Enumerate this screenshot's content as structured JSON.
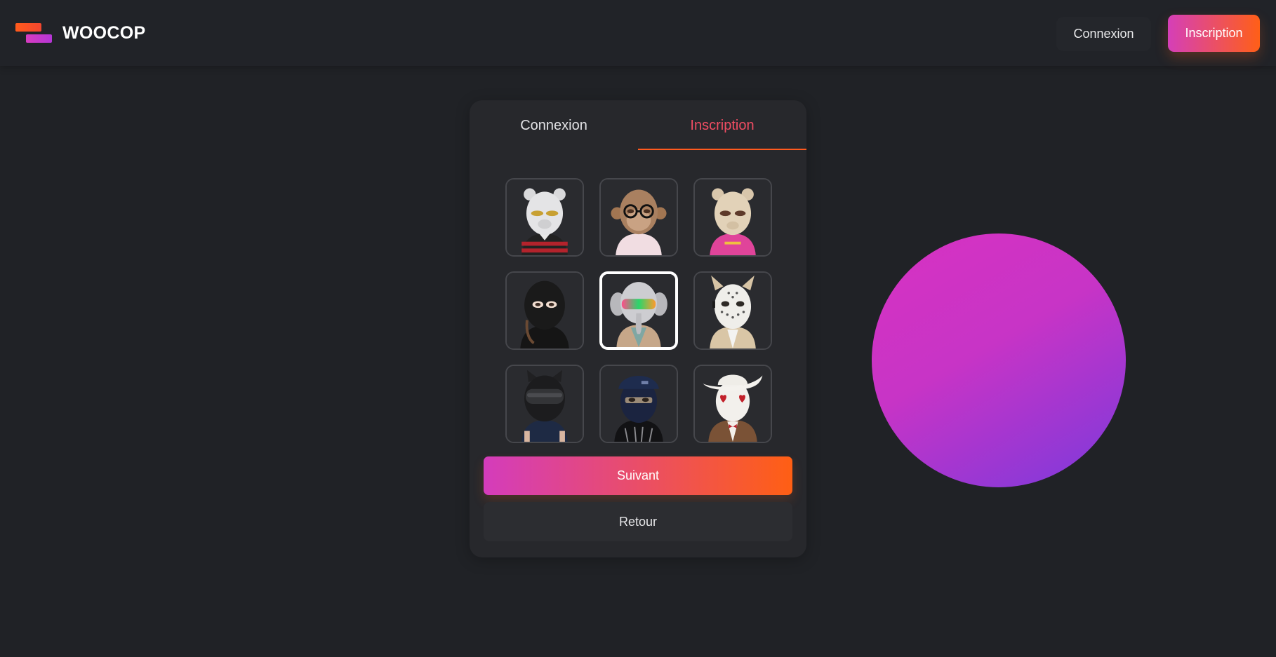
{
  "header": {
    "brand": "WOOCOP",
    "login_label": "Connexion",
    "signup_label": "Inscription"
  },
  "auth_card": {
    "tabs": [
      {
        "label": "Connexion",
        "active": false
      },
      {
        "label": "Inscription",
        "active": true
      }
    ],
    "avatars": [
      {
        "icon": "grey-bear-avatar-icon",
        "selected": false
      },
      {
        "icon": "monkey-glasses-avatar-icon",
        "selected": false
      },
      {
        "icon": "beige-bear-avatar-icon",
        "selected": false
      },
      {
        "icon": "black-hooded-avatar-icon",
        "selected": false
      },
      {
        "icon": "elephant-goggles-avatar-icon",
        "selected": true
      },
      {
        "icon": "hockey-mask-avatar-icon",
        "selected": false
      },
      {
        "icon": "cat-helmet-avatar-icon",
        "selected": false
      },
      {
        "icon": "cap-balaclava-avatar-icon",
        "selected": false
      },
      {
        "icon": "cowboy-hat-avatar-icon",
        "selected": false
      }
    ],
    "next_label": "Suivant",
    "back_label": "Retour"
  },
  "colors": {
    "background": "#202226",
    "accent_pink": "#d43cbc",
    "accent_orange": "#ff5f14",
    "active_tab": "#f04d63"
  }
}
